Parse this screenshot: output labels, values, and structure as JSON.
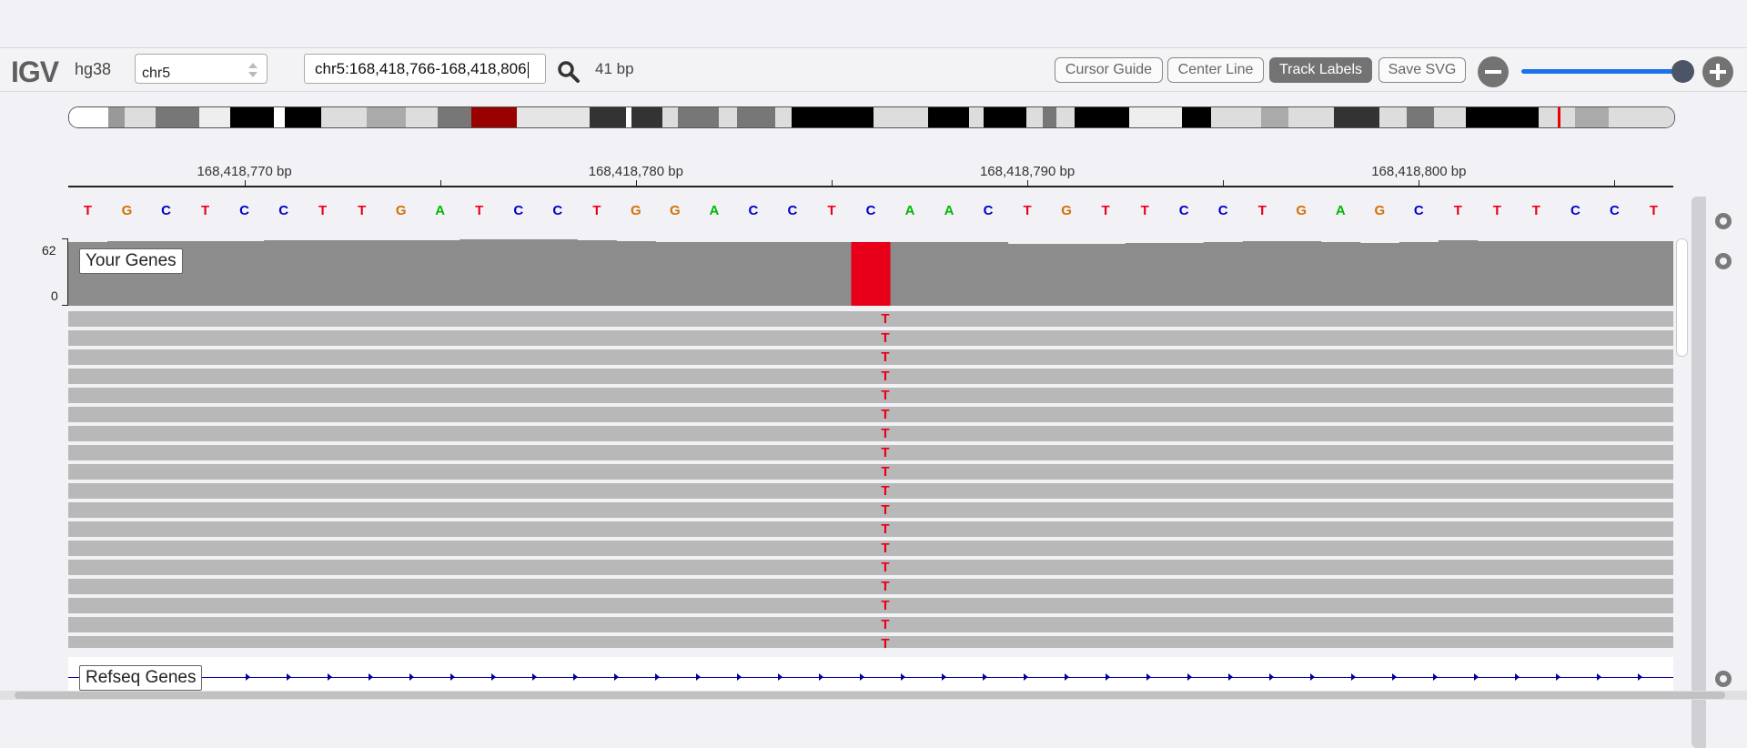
{
  "navbar": {
    "logo": "IGV",
    "genome": "hg38",
    "chromosome": "chr5",
    "locus": "chr5:168,418,766-168,418,806",
    "window_size": "41 bp",
    "buttons": {
      "cursor_guide": "Cursor Guide",
      "center_line": "Center Line",
      "track_labels": "Track Labels",
      "save_svg": "Save SVG"
    },
    "zoom_level": 0.93
  },
  "ruler": {
    "ticks": [
      {
        "label": "168,418,770 bp"
      },
      {
        "label": "168,418,780 bp"
      },
      {
        "label": "168,418,790 bp"
      },
      {
        "label": "168,418,800 bp"
      }
    ]
  },
  "sequence": [
    "T",
    "G",
    "C",
    "T",
    "C",
    "C",
    "T",
    "T",
    "G",
    "A",
    "T",
    "C",
    "C",
    "T",
    "G",
    "G",
    "A",
    "C",
    "C",
    "T",
    "C",
    "A",
    "A",
    "C",
    "T",
    "G",
    "T",
    "T",
    "C",
    "C",
    "T",
    "G",
    "A",
    "G",
    "C",
    "T",
    "T",
    "T",
    "C",
    "C",
    "T"
  ],
  "base_colors": {
    "A": "#00b800",
    "C": "#0000c8",
    "G": "#d17105",
    "T": "#e8001a"
  },
  "coverage": {
    "label": "Your Genes",
    "max": "62",
    "min": "0",
    "bar_color": "#8c8c8c",
    "mismatch_color": "#e8001a",
    "mismatch_index": 20
  },
  "reads": {
    "count": 18,
    "mismatch_base": "T"
  },
  "refseq": {
    "label": "Refseq Genes"
  }
}
